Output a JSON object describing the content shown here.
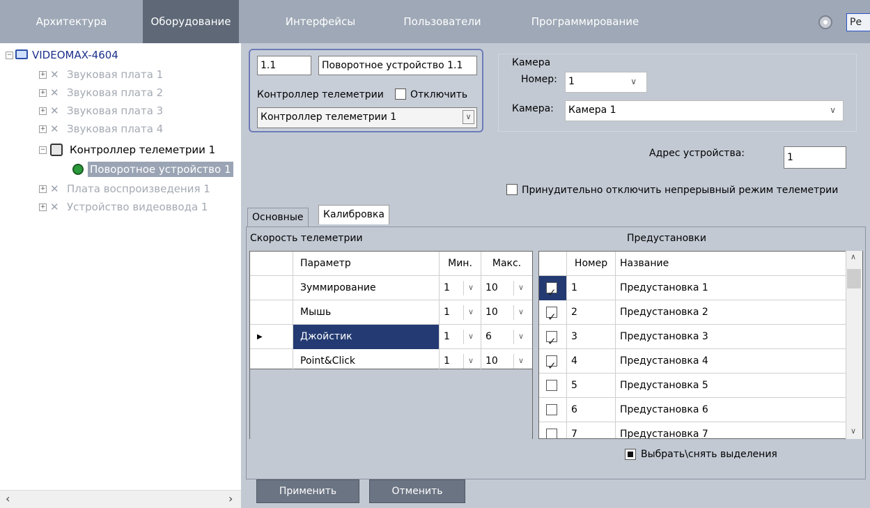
{
  "top_tabs": [
    "Архитектура",
    "Оборудование",
    "Интерфейсы",
    "Пользователи",
    "Программирование"
  ],
  "top_mode_label": "Ре",
  "tree": {
    "root": "VIDEOMAX-4604",
    "sound": [
      "Звуковая плата 1",
      "Звуковая плата 2",
      "Звуковая плата 3",
      "Звуковая плата 4"
    ],
    "telemetry": "Контроллер телеметрии 1",
    "ptz": "Поворотное устройство 1",
    "playback": "Плата воспроизведения 1",
    "video_input": "Устройство видеоввода 1"
  },
  "device": {
    "id": "1.1",
    "name": "Поворотное устройство 1.1",
    "controller_label": "Контроллер телеметрии",
    "disable_label": "Отключить",
    "controller_value": "Контроллер телеметрии 1"
  },
  "camera": {
    "group": "Камера",
    "number_label": "Номер:",
    "number_value": "1",
    "camera_label": "Камера:",
    "camera_value": "Камера 1"
  },
  "address": {
    "label": "Адрес устройства:",
    "value": "1"
  },
  "force_disable_label": "Принудительно отключить непрерывный режим телеметрии",
  "tabs": [
    "Основные",
    "Калибровка"
  ],
  "speed": {
    "title": "Скорость телеметрии",
    "headers": [
      "Параметр",
      "Мин.",
      "Макс."
    ],
    "rows": [
      {
        "param": "Зуммирование",
        "min": "1",
        "max": "10"
      },
      {
        "param": "Мышь",
        "min": "1",
        "max": "10"
      },
      {
        "param": "Джойстик",
        "min": "1",
        "max": "6"
      },
      {
        "param": "Point&Click",
        "min": "1",
        "max": "10"
      }
    ],
    "selected_row": 2
  },
  "presets": {
    "title": "Предустановки",
    "headers": [
      "Номер",
      "Название"
    ],
    "rows": [
      {
        "num": "1",
        "name": "Предустановка 1",
        "checked": true
      },
      {
        "num": "2",
        "name": "Предустановка 2",
        "checked": true
      },
      {
        "num": "3",
        "name": "Предустановка 3",
        "checked": true
      },
      {
        "num": "4",
        "name": "Предустановка 4",
        "checked": true
      },
      {
        "num": "5",
        "name": "Предустановка 5",
        "checked": false
      },
      {
        "num": "6",
        "name": "Предустановка 6",
        "checked": false
      },
      {
        "num": "7",
        "name": "Предустановка 7",
        "checked": false
      }
    ],
    "select_all_label": "Выбрать\\снять выделения"
  },
  "buttons": {
    "apply": "Применить",
    "cancel": "Отменить"
  },
  "colors": {
    "panel": "#c2c9d3",
    "topbar": "#9ea8b6",
    "active_tab": "#5e6877",
    "selected_row": "#233a72"
  }
}
